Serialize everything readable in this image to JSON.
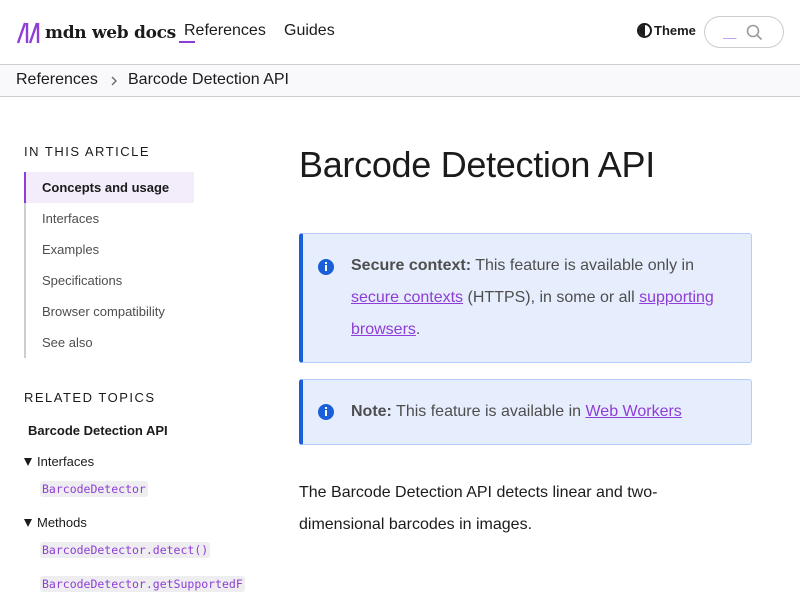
{
  "header": {
    "logo_text": "mdn web docs",
    "nav": [
      "References",
      "Guides"
    ],
    "theme_label": "Theme",
    "search_hint": "__"
  },
  "breadcrumb": [
    "References",
    "Barcode Detection API"
  ],
  "sidebar": {
    "toc_title": "IN THIS ARTICLE",
    "toc_items": [
      "Concepts and usage",
      "Interfaces",
      "Examples",
      "Specifications",
      "Browser compatibility",
      "See also"
    ],
    "toc_active_index": 0,
    "related_title": "RELATED TOPICS",
    "related_main": "Barcode Detection API",
    "groups": {
      "interfaces": {
        "label": "Interfaces",
        "items": [
          "BarcodeDetector"
        ]
      },
      "methods": {
        "label": "Methods",
        "items": [
          "BarcodeDetector.detect()",
          "BarcodeDetector.getSupportedF"
        ]
      }
    }
  },
  "main": {
    "title": "Barcode Detection API",
    "secure": {
      "label": "Secure context:",
      "text1": " This feature is available only in ",
      "link1": "secure contexts",
      "text2": " (HTTPS), in some or all ",
      "link2": "supporting browsers",
      "text3": "."
    },
    "note": {
      "label": "Note:",
      "text1": " This feature is available in ",
      "link1": "Web Workers"
    },
    "intro": "The Barcode Detection API detects linear and two-dimensional barcodes in images."
  },
  "colors": {
    "accent": "#8e3dd6",
    "info_blue": "#1a5fd9",
    "note_bg": "#e6eefd"
  }
}
